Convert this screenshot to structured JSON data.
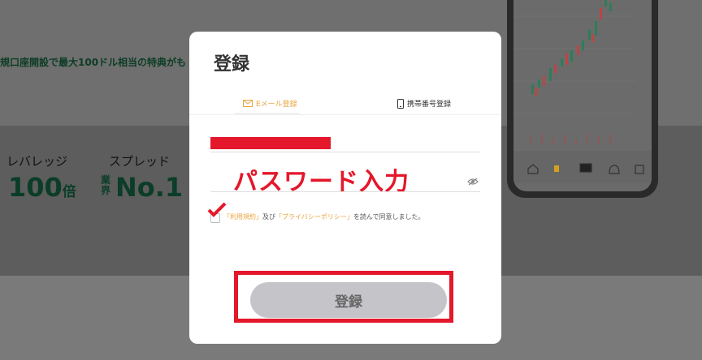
{
  "background": {
    "promo_text": "規口座開設で最大100ドル相当の特典がも",
    "stats": [
      {
        "label": "レバレッジ",
        "value": "100",
        "suffix": "倍"
      },
      {
        "label": "スプレッド",
        "prefix": "業界",
        "value": "No.1"
      }
    ]
  },
  "modal": {
    "title": "登録",
    "tabs": [
      {
        "label": "Eメール登録",
        "icon": "mail-icon",
        "active": true
      },
      {
        "label": "携帯番号登録",
        "icon": "mobile-icon",
        "active": false
      }
    ],
    "password_annotation": "パスワード入力",
    "terms": {
      "link1": "「利用規約」",
      "mid": "及び",
      "link2": "「プライバシーポリシー」",
      "tail": "を読んで同意しました。"
    },
    "submit_label": "登録"
  },
  "colors": {
    "accent": "#e9a640",
    "annotation_red": "#e4172b",
    "button_disabled": "#c4c4c9",
    "stat_green": "#0b3d28"
  }
}
